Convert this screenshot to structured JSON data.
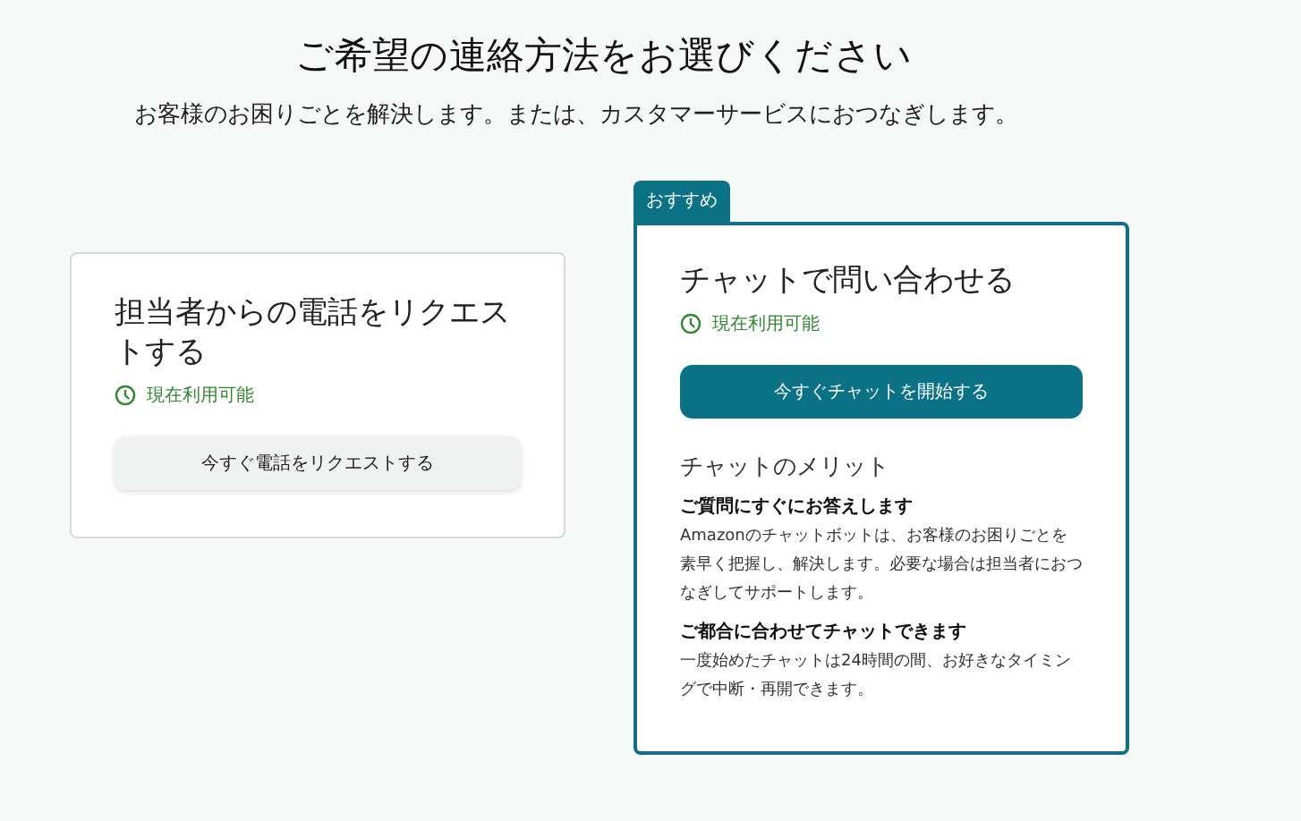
{
  "heading": "ご希望の連絡方法をお選びください",
  "subheading": "お客様のお困りごとを解決します。または、カスタマーサービスにおつなぎします。",
  "options": [
    {
      "kind": "phone",
      "recommended": false,
      "title": "担当者からの電話をリクエストする",
      "status": "現在利用可能",
      "button": "今すぐ電話をリクエストする"
    },
    {
      "kind": "chat",
      "recommended": true,
      "badge": "おすすめ",
      "title": "チャットで問い合わせる",
      "status": "現在利用可能",
      "button": "今すぐチャットを開始する",
      "benefits_title": "チャットのメリット",
      "benefits": [
        {
          "title": "ご質問にすぐにお答えします",
          "text": "Amazonのチャットボットは、お客様のお困りごとを素早く把握し、解決します。必要な場合は担当者におつなぎしてサポートします。"
        },
        {
          "title": "ご都合に合わせてチャットできます",
          "text": "一度始めたチャットは24時間の間、お好きなタイミングで中断・再開できます。"
        }
      ]
    }
  ]
}
